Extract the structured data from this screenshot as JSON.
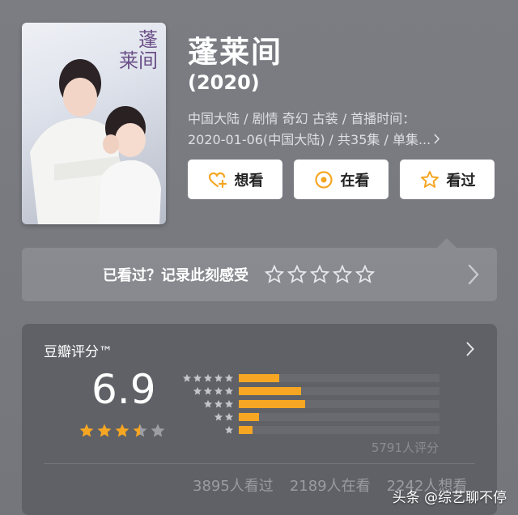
{
  "poster": {
    "calligraphy_lines": [
      "蓬",
      "莱间"
    ]
  },
  "title": "蓬莱间",
  "year": "(2020)",
  "meta": {
    "line1": "中国大陆 / 剧情 奇幻 古装 / 首播时间：",
    "line2": "2020-01-06(中国大陆) / 共35集 / 单集...",
    "more_icon": "chevron-right-icon"
  },
  "actions": [
    {
      "label": "想看",
      "icon": "heart-plus-icon"
    },
    {
      "label": "在看",
      "icon": "target-icon"
    },
    {
      "label": "看过",
      "icon": "star-outline-icon"
    }
  ],
  "record": {
    "label": "已看过？记录此刻感受",
    "star_count": 5
  },
  "rating": {
    "header": "豆瓣评分™",
    "score": "6.9",
    "stars": 3.5,
    "distribution": [
      {
        "stars": 5,
        "share": 0.2
      },
      {
        "stars": 4,
        "share": 0.31
      },
      {
        "stars": 3,
        "share": 0.33
      },
      {
        "stars": 2,
        "share": 0.1
      },
      {
        "stars": 1,
        "share": 0.07
      }
    ],
    "total": "5791人评分",
    "stats": [
      "3895人看过",
      "2189人在看",
      "2242人想看"
    ]
  },
  "watermark": "头条 @综艺聊不停",
  "colors": {
    "accent": "#f6a623",
    "background": "#7b7d83",
    "card": "#5f6166"
  }
}
